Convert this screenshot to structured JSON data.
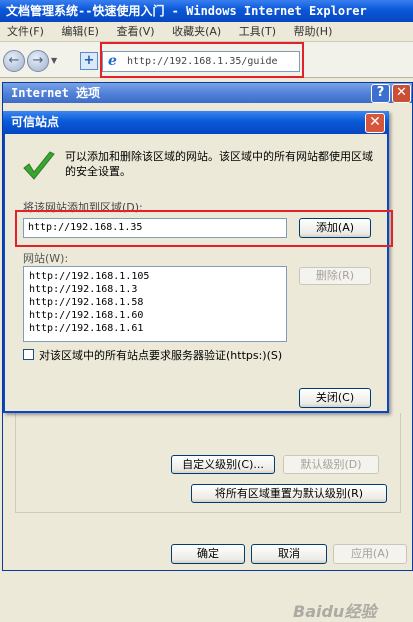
{
  "ie_window": {
    "title": "文档管理系统--快速使用入门 - Windows Internet Explorer",
    "menu": [
      "文件(F)",
      "编辑(E)",
      "查看(V)",
      "收藏夹(A)",
      "工具(T)",
      "帮助(H)"
    ],
    "address": "http://192.168.1.35/guide"
  },
  "internet_options": {
    "title": "Internet 选项",
    "custom_level_label": "自定义级别(C)...",
    "default_level_label": "默认级别(D)",
    "reset_all_label": "将所有区域重置为默认级别(R)",
    "ok_label": "确定",
    "cancel_label": "取消",
    "apply_label": "应用(A)"
  },
  "trusted_sites": {
    "title": "可信站点",
    "description": "可以添加和删除该区域的网站。该区域中的所有网站都使用区域的安全设置。",
    "add_label": "将该网站添加到区域(D):",
    "add_input_value": "http://192.168.1.35",
    "add_button": "添加(A)",
    "websites_label": "网站(W):",
    "websites": [
      "http://192.168.1.105",
      "http://192.168.1.3",
      "http://192.168.1.58",
      "http://192.168.1.60",
      "http://192.168.1.61"
    ],
    "remove_button": "删除(R)",
    "https_label": "对该区域中的所有站点要求服务器验证(https:)(S)",
    "https_checked": false,
    "close_button": "关闭(C)"
  },
  "watermark": "Baidu经验",
  "colors": {
    "highlight_box": "#e2222a",
    "titlebar_blue": "#0a5ad8",
    "check_green": "#3aa531"
  }
}
